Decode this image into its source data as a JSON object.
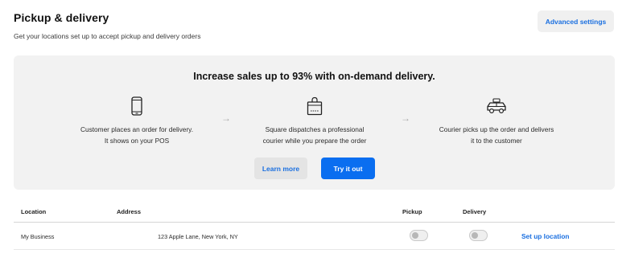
{
  "header": {
    "title": "Pickup & delivery",
    "subtitle": "Get your locations set up to accept pickup and delivery orders",
    "advanced_settings_label": "Advanced settings"
  },
  "promo": {
    "headline": "Increase sales up to 93% with on-demand delivery.",
    "steps": [
      {
        "icon": "phone-icon",
        "line1": "Customer places an order for delivery.",
        "line2": "It shows on your POS"
      },
      {
        "icon": "bag-icon",
        "line1": "Square dispatches a professional",
        "line2": "courier while you prepare the order"
      },
      {
        "icon": "car-icon",
        "line1": "Courier picks up the order and delivers",
        "line2": "it to the customer"
      }
    ],
    "arrow": "→",
    "learn_more_label": "Learn more",
    "try_it_label": "Try it out"
  },
  "table": {
    "columns": {
      "location": "Location",
      "address": "Address",
      "pickup": "Pickup",
      "delivery": "Delivery"
    },
    "rows": [
      {
        "location": "My Business",
        "address": "123 Apple Lane, New York, NY",
        "pickup_enabled": false,
        "delivery_enabled": false,
        "action_label": "Set up location"
      }
    ]
  },
  "colors": {
    "accent": "#1a6fe0",
    "primary_button": "#0a6ef0",
    "promo_background": "#f2f2f2"
  }
}
